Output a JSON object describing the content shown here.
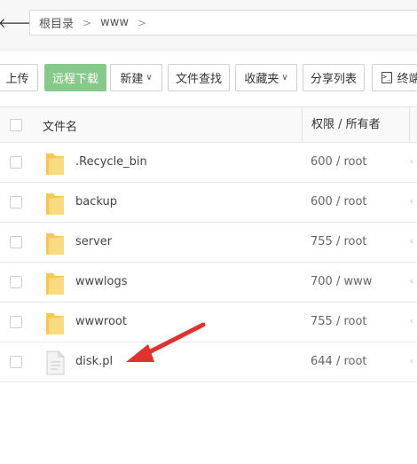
{
  "nav": {
    "breadcrumbs": [
      "根目录",
      "www"
    ]
  },
  "toolbar": {
    "upload": "上传",
    "remote_download": "远程下载",
    "new": "新建",
    "file_search": "文件查找",
    "favorites": "收藏夹",
    "share_list": "分享列表",
    "terminal": "终端"
  },
  "table": {
    "headers": {
      "name": "文件名",
      "permission": "权限 / 所有者"
    },
    "rows": [
      {
        "name": ".Recycle_bin",
        "permission": "600 / root",
        "type": "folder-icon"
      },
      {
        "name": "backup",
        "permission": "600 / root",
        "type": "folder-icon"
      },
      {
        "name": "server",
        "permission": "755 / root",
        "type": "folder-icon"
      },
      {
        "name": "wwwlogs",
        "permission": "700 / www",
        "type": "folder-icon"
      },
      {
        "name": "wwwroot",
        "permission": "755 / root",
        "type": "folder-icon"
      },
      {
        "name": "disk.pl",
        "permission": "644 / root",
        "type": "file-icon"
      }
    ]
  },
  "colors": {
    "primary_button": "#87c98b",
    "folder": "#f5c75a",
    "annotation_arrow": "#e0322f"
  }
}
